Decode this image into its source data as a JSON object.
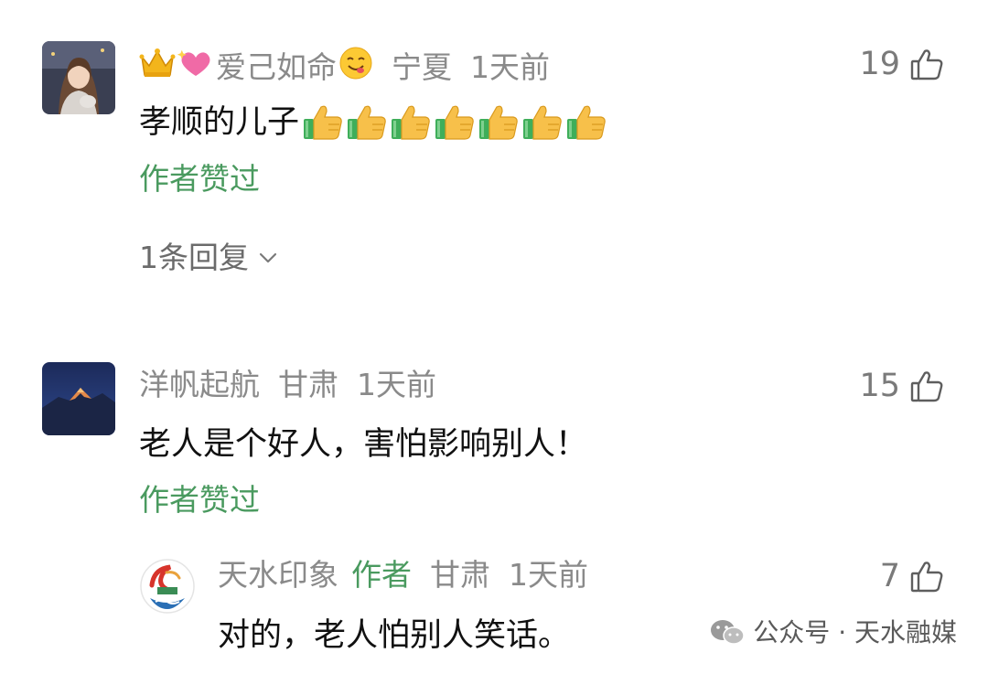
{
  "comments": [
    {
      "user": "爱己如命",
      "location": "宁夏",
      "time": "1天前",
      "likes": "19",
      "text": "孝顺的儿子",
      "thumbs_emoji_count": 7,
      "liked_by_author": "作者赞过",
      "replies_label": "1条回复"
    },
    {
      "user": "洋帆起航",
      "location": "甘肃",
      "time": "1天前",
      "likes": "15",
      "text": "老人是个好人，害怕影响别人！",
      "liked_by_author": "作者赞过",
      "reply": {
        "user": "天水印象",
        "badge": "作者",
        "location": "甘肃",
        "time": "1天前",
        "likes": "7",
        "text": "对的，老人怕别人笑话。"
      }
    }
  ],
  "watermark": {
    "text": "公众号 · 天水融媒"
  },
  "icons": {
    "like": "thumbs-up-outline-icon",
    "expand": "chevron-down-icon",
    "watermark": "wechat-icon"
  },
  "colors": {
    "author_green": "#4a9a5f",
    "meta_gray": "#8a8a8a"
  }
}
